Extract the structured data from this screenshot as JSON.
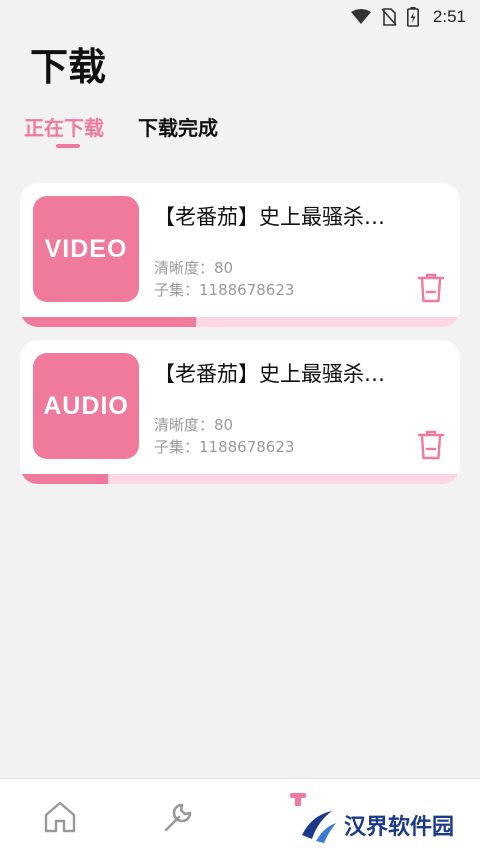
{
  "status_bar": {
    "time": "2:51"
  },
  "page": {
    "title": "下载"
  },
  "tabs": [
    {
      "label": "正在下载",
      "active": true
    },
    {
      "label": "下载完成",
      "active": false
    }
  ],
  "downloads": [
    {
      "thumb_label": "VIDEO",
      "title": "【老番茄】史上最骚杀…",
      "quality": "清晰度：80",
      "episode": "子集：1188678623",
      "progress": 0.4
    },
    {
      "thumb_label": "AUDIO",
      "title": "【老番茄】史上最骚杀…",
      "quality": "清晰度：80",
      "episode": "子集：1188678623",
      "progress": 0.2
    }
  ],
  "bottom_nav": [
    {
      "icon": "home-icon"
    },
    {
      "icon": "wrench-icon"
    },
    {
      "icon": "download-icon"
    }
  ],
  "watermark": {
    "text": "汉界软件园"
  },
  "colors": {
    "accent": "#f07a9c",
    "track": "#fcd6e2",
    "background": "#f2f2f2"
  }
}
